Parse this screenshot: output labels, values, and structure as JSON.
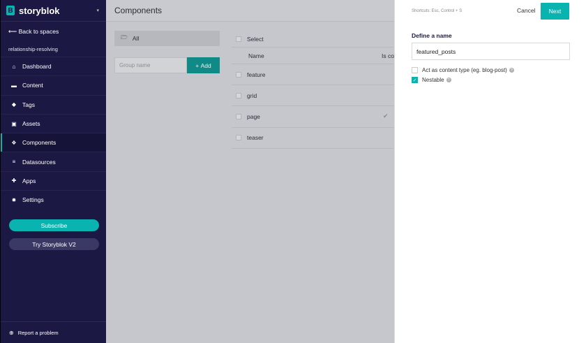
{
  "brand": {
    "logo_letter": "B",
    "name": "storyblok",
    "caret": "▾"
  },
  "sidebar": {
    "back_label": "Back to spaces",
    "space_name": "relationship-resolving",
    "items": [
      {
        "label": "Dashboard",
        "icon": "home-icon",
        "glyph": "⌂"
      },
      {
        "label": "Content",
        "icon": "folder-icon",
        "glyph": "▬"
      },
      {
        "label": "Tags",
        "icon": "tags-icon",
        "glyph": "◆"
      },
      {
        "label": "Assets",
        "icon": "image-icon",
        "glyph": "▣"
      },
      {
        "label": "Components",
        "icon": "cubes-icon",
        "glyph": "❖"
      },
      {
        "label": "Datasources",
        "icon": "database-icon",
        "glyph": "≡"
      },
      {
        "label": "Apps",
        "icon": "puzzle-icon",
        "glyph": "✚"
      },
      {
        "label": "Settings",
        "icon": "gear-icon",
        "glyph": "✹"
      }
    ],
    "subscribe_label": "Subscribe",
    "try_label": "Try Storyblok V2",
    "report_label": "Report a problem"
  },
  "main": {
    "title": "Components",
    "folder_label": "All",
    "group_placeholder": "Group name",
    "add_label": "Add",
    "select_label": "Select",
    "col_name": "Name",
    "col_is_content": "Is co",
    "rows": [
      "feature",
      "grid",
      "page",
      "teaser"
    ]
  },
  "panel": {
    "shortcuts": "Shortcuts: Esc, Control + S",
    "cancel_label": "Cancel",
    "next_label": "Next",
    "define_label": "Define a name",
    "name_value": "featured_posts",
    "opt_content_type": "Act as content type (eg. blog-post)",
    "opt_nestable": "Nestable"
  },
  "colors": {
    "accent": "#09b3af",
    "sidebar_bg": "#1b1943"
  }
}
